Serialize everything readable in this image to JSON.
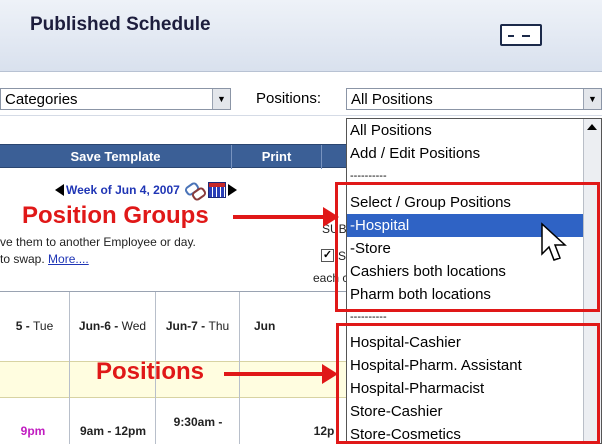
{
  "header": {
    "title": "Published Schedule"
  },
  "filters": {
    "categories_value": "Categories",
    "positions_label": "Positions:",
    "positions_value": "All Positions"
  },
  "toolbar": {
    "save_template": "Save Template",
    "print": "Print"
  },
  "week_nav": {
    "label": "Week of Jun 4, 2007"
  },
  "hint": {
    "line1": "ve them to another Employee or day.",
    "line2": "to swap.",
    "more_link": "More...."
  },
  "side_fragments": {
    "a": "SUBC",
    "b": "Se",
    "c": "each c"
  },
  "annotations": {
    "position_groups": "Position Groups",
    "positions": "Positions"
  },
  "grid": {
    "columns": [
      {
        "date": "5 - ",
        "dow": "Tue"
      },
      {
        "date": "Jun-6 - ",
        "dow": "Wed"
      },
      {
        "date": "Jun-7 - ",
        "dow": "Thu"
      },
      {
        "date": "Jun",
        "dow": ""
      }
    ],
    "cells": [
      "9pm",
      "9am - 12pm",
      "9:30am -",
      "12p"
    ]
  },
  "dropdown": {
    "options": [
      "All Positions",
      "Add / Edit Positions",
      "----------",
      "Select / Group Positions",
      "-Hospital",
      "-Store",
      "Cashiers both locations",
      "Pharm both locations",
      "----------",
      "Hospital-Cashier",
      "Hospital-Pharm. Assistant",
      "Hospital-Pharmacist",
      "Store-Cashier",
      "Store-Cosmetics"
    ],
    "selected_index": 4
  },
  "colors": {
    "accent": "#2f63c5",
    "annotation": "#e01818",
    "toolbar": "#3b5f96"
  }
}
